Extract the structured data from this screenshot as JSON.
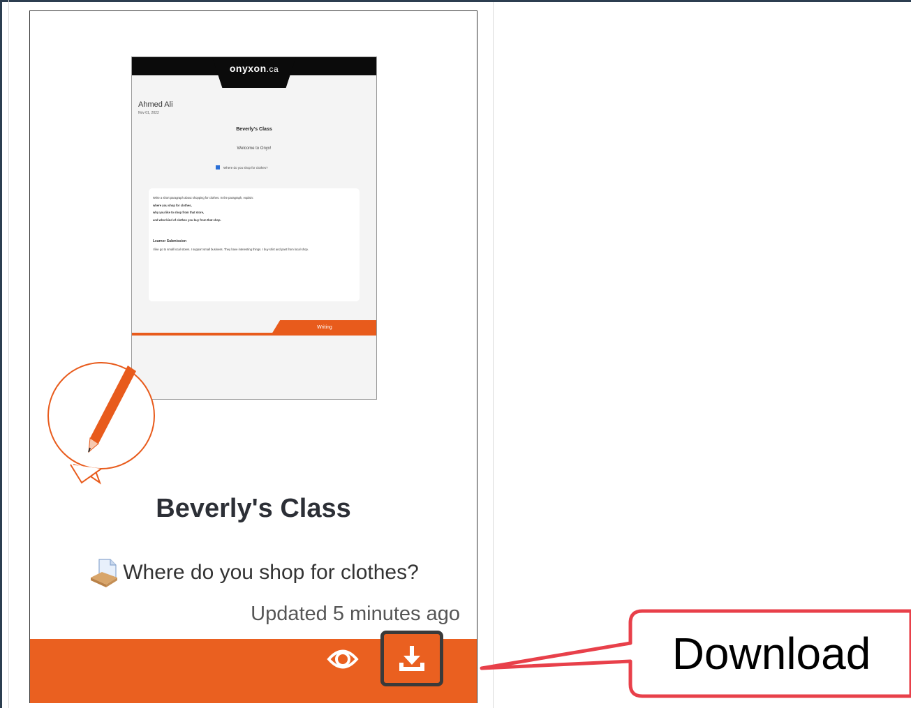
{
  "thumbnail": {
    "brand": "onyxon",
    "brand_domain": ".ca",
    "user_name": "Ahmed Ali",
    "date": "Nov 01, 2022",
    "class_name": "Beverly's Class",
    "welcome": "Welcome to Onyx!",
    "question": "Where do you shop for clothes?",
    "prompt": "Write a short paragraph about shopping for clothes. In the paragraph, explain:",
    "points": [
      "where you shop for clothes,",
      "why you like to shop from that store,",
      "and what kind of clothes you buy from that shop."
    ],
    "submission_heading": "Learner Submission",
    "submission_text": "I like go to small local stores. I support small business. They have interesting things. I buy shirt and pant from local shop.",
    "category": "Writing"
  },
  "card": {
    "title": "Beverly's Class",
    "activity": "Where do you shop for clothes?",
    "updated": "Updated 5 minutes ago"
  },
  "callout": {
    "label": "Download"
  },
  "colors": {
    "accent": "#ea6020",
    "callout_border": "#e8404a"
  }
}
